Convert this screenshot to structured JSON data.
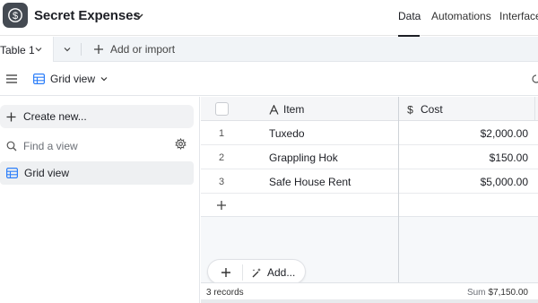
{
  "app": {
    "title": "Secret Expenses",
    "icon": "dollar-icon"
  },
  "nav": {
    "data": "Data",
    "automations": "Automations",
    "interfaces": "Interfaces"
  },
  "tabs": {
    "active_table": "Table 1",
    "add_or_import": "Add or import"
  },
  "toolbar": {
    "view_name": "Grid view"
  },
  "sidebar": {
    "create_new": "Create new...",
    "find_placeholder": "Find a view",
    "views": [
      {
        "label": "Grid view"
      }
    ]
  },
  "grid": {
    "columns": [
      {
        "label": "Item",
        "icon": "text-field-icon"
      },
      {
        "label": "Cost",
        "icon": "currency-field-icon"
      }
    ],
    "rows": [
      {
        "num": "1",
        "item": "Tuxedo",
        "cost": "$2,000.00"
      },
      {
        "num": "2",
        "item": "Grappling Hok",
        "cost": "$150.00"
      },
      {
        "num": "3",
        "item": "Safe House Rent",
        "cost": "$5,000.00"
      }
    ],
    "add_label": "Add...",
    "footer": {
      "records": "3 records",
      "sum_label": "Sum",
      "sum_value": "$7,150.00"
    }
  },
  "colors": {
    "app_icon_bg": "#444a52",
    "tab_bar_bg": "#f1f4f7",
    "accent_view_icon": "#2d7ff9"
  }
}
